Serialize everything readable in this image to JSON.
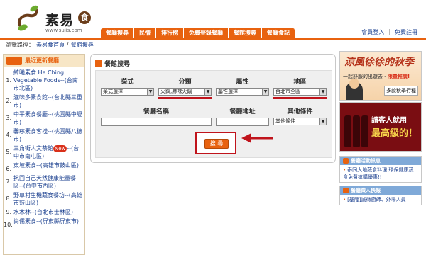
{
  "header": {
    "logo_text": "素易",
    "logo_badge": "食",
    "logo_url": "www.suiis.com",
    "nav": [
      "餐廳搜尋",
      "民情",
      "排行榜",
      "免費登錄餐廳",
      "餐館搜尋",
      "餐廳食記"
    ],
    "user_links": [
      "會員登入",
      "免費註冊"
    ]
  },
  "breadcrumb": {
    "label": "瀏覽路徑：",
    "items": [
      "素易食首頁",
      "餐館搜尋"
    ],
    "separator": "/"
  },
  "sidebar": {
    "title": "最近更新餐廳",
    "items": [
      {
        "num": "1.",
        "text": "綺曦素食 He Ching Vegetable Foods--(台南市北區)"
      },
      {
        "num": "2.",
        "text": "滋味多素食館--(台北縣三重市)"
      },
      {
        "num": "3.",
        "text": "中平素食餐廳--(桃園縣中壢市)"
      },
      {
        "num": "4.",
        "text": "馨慈素食客棧--(桃園縣八德市)"
      },
      {
        "num": "5.",
        "text": "三角街人文茶館",
        "badge": "New",
        "suffix": "--(台中市南屯區)"
      },
      {
        "num": "6.",
        "text": "東坡素食--(高雄市鼓山區)"
      },
      {
        "num": "7.",
        "text": "抗回自己天然健康能量餐區--(台中市西區)"
      },
      {
        "num": "8.",
        "text": "野草村生機蔬食餐坊--(高雄市鼓山區)"
      },
      {
        "num": "9.",
        "text": "水木林--(台北市士林區)"
      },
      {
        "num": "10.",
        "text": "尚儒素食--(屏東縣屏東市)"
      }
    ]
  },
  "search": {
    "title": "餐館搜尋",
    "filters": [
      {
        "label": "菜式",
        "value": "菜式選擇",
        "highlight": false
      },
      {
        "label": "分類",
        "value": "火鍋,麻辣火鍋",
        "highlight": true
      },
      {
        "label": "屬性",
        "value": "屬性選擇",
        "highlight": false
      },
      {
        "label": "地區",
        "value": "台北市全區",
        "highlight": true
      }
    ],
    "name_label": "餐廳名稱",
    "name_value": "",
    "address_label": "餐廳地址",
    "address_value": "",
    "other_label": "其他條件",
    "other_value": "其他條件",
    "submit_label": "搜 尋",
    "accent": "#e8620f",
    "highlight_color": "#c0141c"
  },
  "ads": {
    "ad1_title": "涼風徐徐的秋季",
    "ad1_sub": "一起舒服的出遊去 - ",
    "ad1_sub_hl": "限量推廣!",
    "ad1_tag": "多款秋季行程",
    "ad2_line1": "請客人就用",
    "ad2_line2": "最高級的！"
  },
  "side_boxes": [
    {
      "title": "餐廳活動訊息",
      "items": [
        "泰同大地蔬食料理 環保健康蔬食免費搶購優惠!!"
      ]
    },
    {
      "title": "餐廳徵人快報",
      "items": [
        "[基隆]誠徵廚師、外場人員"
      ]
    }
  ]
}
